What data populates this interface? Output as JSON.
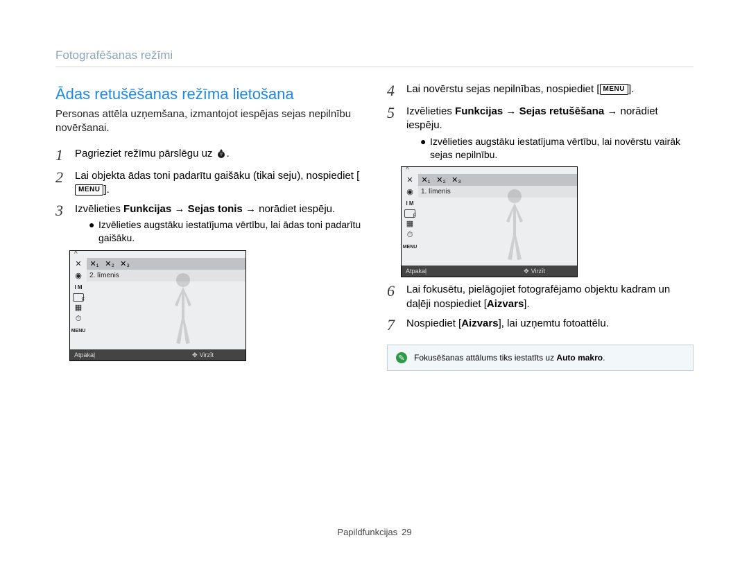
{
  "breadcrumb": "Fotografēšanas režīmi",
  "title": "Ādas retušēšanas režīma lietošana",
  "subtitle": "Personas attēla uzņemšana, izmantojot iespējas sejas nepilnību novēršanai.",
  "menu_label": "MENU",
  "left": {
    "s1_a": "Pagrieziet režīmu pārslēgu uz ",
    "s1_b": ".",
    "s2_a": "Lai objekta ādas toni padarītu gaišāku (tikai seju), nospiediet [",
    "s2_b": "].",
    "s3_a": "Izvēlieties ",
    "s3_b": "Funkcijas",
    "s3_c": " → ",
    "s3_d": "Sejas tonis",
    "s3_e": " → norādiet iespēju.",
    "s3_bullet": "Izvēlieties augstāku iestatījuma vērtību, lai ādas toni padarītu gaišāku."
  },
  "right": {
    "s4_a": "Lai novērstu sejas nepilnības, nospiediet [",
    "s4_b": "].",
    "s5_a": "Izvēlieties ",
    "s5_b": "Funkcijas",
    "s5_c": " → ",
    "s5_d": "Sejas retušēšana",
    "s5_e": " → norādiet iespēju.",
    "s5_bullet": "Izvēlieties augstāku iestatījuma vērtību, lai novērstu vairāk sejas nepilnību.",
    "s6_a": "Lai fokusētu, pielāgojiet fotografējamo objektu kadram un daļēji nospiediet [",
    "s6_b": "Aizvars",
    "s6_c": "].",
    "s7_a": "Nospiediet [",
    "s7_b": "Aizvars",
    "s7_c": "], lai uzņemtu fotoattēlu."
  },
  "mini_left": {
    "level": "2. līmenis",
    "back": "Atpakaļ",
    "move": "Virzīt"
  },
  "mini_right": {
    "level": "1. līmenis",
    "back": "Atpakaļ",
    "move": "Virzīt"
  },
  "mini_top_cells": [
    "✕₁",
    "✕₂",
    "✕₃"
  ],
  "note_a": "Fokusēšanas attālums tiks iestatīts uz ",
  "note_b": "Auto makro",
  "note_c": ".",
  "footer_label": "Papildfunkcijas",
  "footer_page": "29"
}
